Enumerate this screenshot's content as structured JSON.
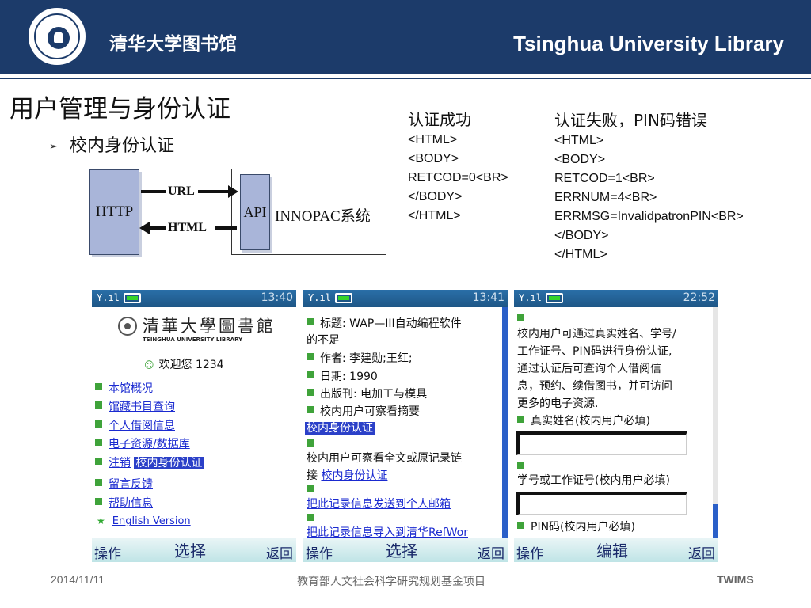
{
  "header": {
    "cn_title": "清华大学图书馆",
    "en_title": "Tsinghua University Library",
    "color": "#1c3b6a"
  },
  "slide": {
    "title": "用户管理与身份认证",
    "bullet": "校内身份认证"
  },
  "diagram": {
    "http_label": "HTTP",
    "api_label": "API",
    "innopac_label": "INNOPAC系统",
    "url_label": "URL",
    "html_label": "HTML"
  },
  "auth_success": {
    "heading": "认证成功",
    "lines": [
      "<HTML>",
      "<BODY>",
      "RETCOD=0<BR>",
      "</BODY>",
      "</HTML>"
    ]
  },
  "auth_fail": {
    "heading": "认证失败，PIN码错误",
    "lines": [
      "<HTML>",
      "<BODY>",
      "RETCOD=1<BR>",
      "ERRNUM=4<BR>",
      "ERRMSG=InvalidpatronPIN<BR>",
      "</BODY>",
      "</HTML>"
    ]
  },
  "phones": [
    {
      "time": "13:40",
      "logo_name": "清華大學圖書館",
      "logo_en": "TSINGHUA UNIVERSITY LIBRARY",
      "welcome": "欢迎您 1234",
      "menu": [
        "本馆概况",
        "馆藏书目查询",
        "个人借阅信息",
        "电子资源/数据库"
      ],
      "logout": "注销",
      "logout_selected": "校内身份认证",
      "menu2": [
        "留言反馈",
        "帮助信息"
      ],
      "english": "English Version",
      "softkeys": {
        "left": "操作",
        "mid": "选择",
        "right": "返回"
      }
    },
    {
      "time": "13:41",
      "title_line1": "标题: WAP—III自动编程软件",
      "title_line2": "的不足",
      "author": "作者: 李建勋;王红;",
      "date": "日期: 1990",
      "journal": "出版刊: 电加工与模具",
      "abstract_note": "校内用户可察看摘要",
      "auth_link_selected": "校内身份认证",
      "fulltext_note1": "校内用户可察看全文或原记录链",
      "fulltext_note2_prefix": "接",
      "fulltext_note2_link": "校内身份认证",
      "email_link": "把此记录信息发送到个人邮箱",
      "export_link": "把此记录信息导入到清华RefWor",
      "softkeys": {
        "left": "操作",
        "mid": "选择",
        "right": "返回"
      }
    },
    {
      "time": "22:52",
      "intro": [
        "校内用户可通过真实姓名、学号/",
        "工作证号、PIN码进行身份认证,",
        "通过认证后可查询个人借阅信",
        "息，预约、续借图书，并可访问",
        "更多的电子资源."
      ],
      "field1_label": "真实姓名(校内用户必填)",
      "field2_label": "学号或工作证号(校内用户必填)",
      "field3_label": "PIN码(校内用户必填)",
      "softkeys": {
        "left": "操作",
        "mid": "编辑",
        "right": "返回"
      }
    }
  ],
  "footer": {
    "date": "2014/11/11",
    "project": "教育部人文社会科学研究规划基金项目",
    "brand": "TWIMS"
  }
}
